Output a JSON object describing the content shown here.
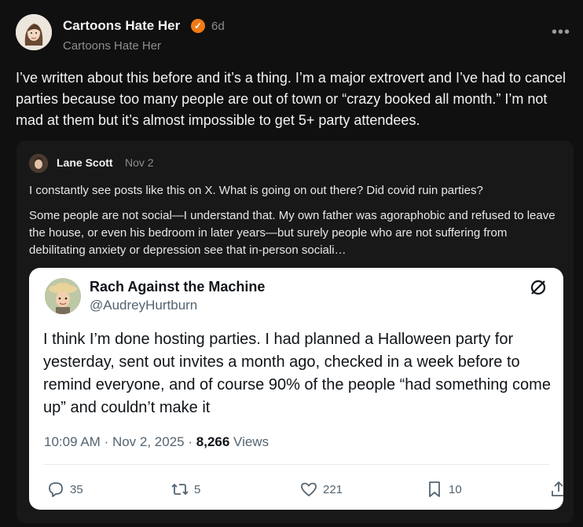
{
  "post": {
    "author_name": "Cartoons Hate Her",
    "time_ago": "6d",
    "handle": "Cartoons Hate Her",
    "more_label": "•••",
    "text": "I’ve written about this before and it’s a thing. I’m a major extrovert and I’ve had to cancel parties because too many people are out of town or “crazy booked all month.” I’m not mad at them but it’s almost impossible to get 5+ party attendees.",
    "verified_color": "#f07a16"
  },
  "quote": {
    "author_name": "Lane Scott",
    "date": "Nov 2",
    "paragraph1": "I constantly see posts like this on X. What is going on out there? Did covid ruin parties?",
    "paragraph2": "Some people are not social—I understand that. My own father was agoraphobic and refused to leave the house, or even his bedroom in later years—but surely people who are not suffering from debilitating anxiety or depression see that in-person sociali…"
  },
  "embedded_tweet": {
    "name": "Rach Against the Machine",
    "handle": "@AudreyHurtburn",
    "text": "I think I’m done hosting parties. I had planned a Halloween party for yesterday, sent out invites a month ago, checked in a week before to remind everyone, and of course 90% of the people “had something come up” and couldn’t make it",
    "time": "10:09 AM",
    "date": "Nov 2, 2025",
    "views_count": "8,266",
    "views_label": "Views",
    "replies": "35",
    "reposts": "5",
    "likes": "221",
    "bookmarks": "10"
  }
}
